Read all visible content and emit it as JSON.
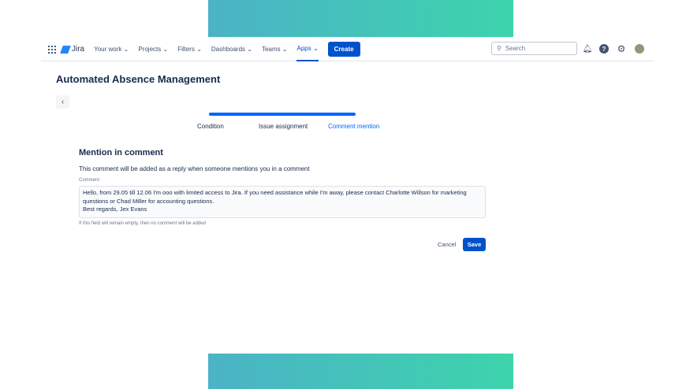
{
  "nav": {
    "logo": "Jira",
    "items": [
      "Your work",
      "Projects",
      "Filters",
      "Dashboards",
      "Teams",
      "Apps"
    ],
    "active": "Apps",
    "create": "Create",
    "search_placeholder": "Search"
  },
  "page": {
    "title": "Automated Absence Management",
    "steps": [
      "Condition",
      "Issue assignment",
      "Comment mention"
    ],
    "active_step": "Comment mention"
  },
  "form": {
    "heading": "Mention in comment",
    "description": "This comment will be added as a reply when someone mentions you in a comment",
    "comment_label": "Comment",
    "comment_value": "Hello, from 29.05 till 12.06 I'm ooo with limited access to Jira. If you need assistance while I'm away, please contact Charlotte Willson for marketing questions or Chad Miller for accounting questions.\nBest regards, Jex Evans",
    "hint": "If this field will remain empty, then no comment will be added",
    "cancel": "Cancel",
    "save": "Save"
  }
}
